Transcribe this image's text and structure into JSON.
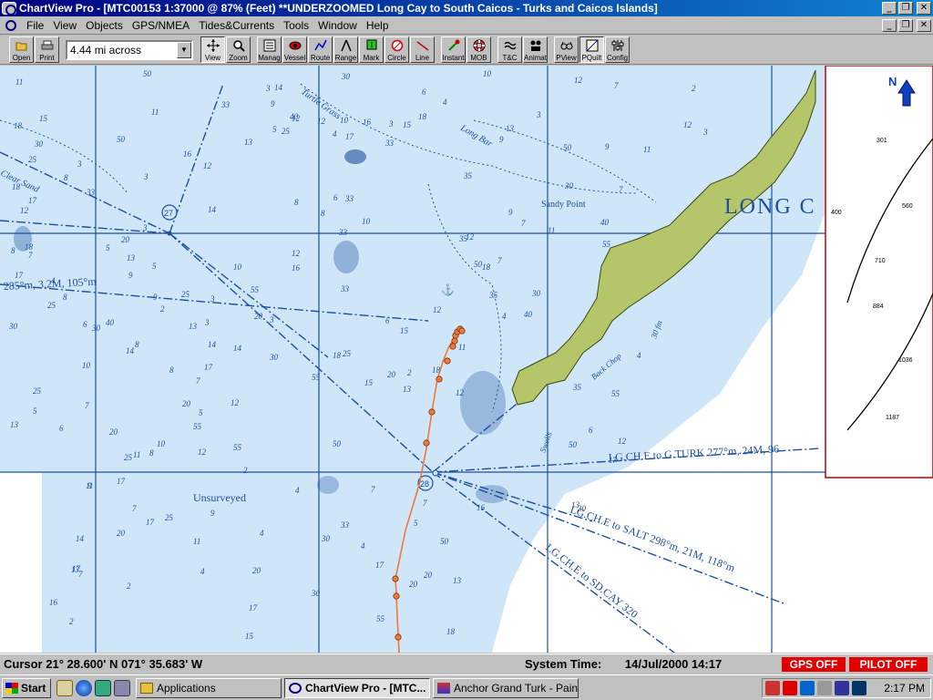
{
  "window": {
    "title": "ChartView Pro - [MTC00153 1:37000 @ 87% (Feet) **UNDERZOOMED Long Cay to South Caicos - Turks and Caicos Islands]",
    "controls": {
      "minimize": "_",
      "restore": "❐",
      "close": "✕"
    }
  },
  "menu": [
    "File",
    "View",
    "Objects",
    "GPS/NMEA",
    "Tides&Currents",
    "Tools",
    "Window",
    "Help"
  ],
  "toolbar": {
    "scale_value": "4.44 mi across",
    "buttons": [
      {
        "label": "Open",
        "icon": "open-folder-icon"
      },
      {
        "label": "Print",
        "icon": "printer-icon"
      },
      {
        "label": "View",
        "icon": "crosshair-icon"
      },
      {
        "label": "Zoom",
        "icon": "magnifier-icon"
      },
      {
        "label": "Manag",
        "icon": "manage-list-icon"
      },
      {
        "label": "Vessel",
        "icon": "vessel-eye-icon"
      },
      {
        "label": "Route",
        "icon": "route-icon"
      },
      {
        "label": "Range",
        "icon": "range-compass-icon"
      },
      {
        "label": "Mark",
        "icon": "mark-flag-icon"
      },
      {
        "label": "Circle",
        "icon": "circle-icon"
      },
      {
        "label": "Line",
        "icon": "line-icon"
      },
      {
        "label": "Instant",
        "icon": "instant-waypoint-icon"
      },
      {
        "label": "MOB",
        "icon": "lifebuoy-icon"
      },
      {
        "label": "T&C",
        "icon": "tides-currents-icon"
      },
      {
        "label": "Animat",
        "icon": "animate-icon"
      },
      {
        "label": "PView",
        "icon": "pview-glasses-icon"
      },
      {
        "label": "PQuilt",
        "icon": "pquilt-icon"
      },
      {
        "label": "Config",
        "icon": "config-sliders-icon"
      }
    ]
  },
  "chart": {
    "place_label": "LONG C",
    "labels": {
      "unsurveyed": "Unsurveyed",
      "turtle_grass": "Turtle Grass",
      "long_bar": "Long Bar",
      "sandy_point": "Sandy Point",
      "back_chop": "Back Chop",
      "swells": "Swells",
      "clear_sand": "Clear Sand",
      "bearing_285": "285°m, 3.2M, 105°m",
      "route_gturk": "LG.CH.E to G.TURK  277°m, 24M, 96",
      "route_salt": "LG.CH.E to SALT  298°m, 21M, 118°m",
      "route_sdcay": "LG.CH.E to SD.CAY  320",
      "fathom_30": "30 fm",
      "waypoint_27": "27",
      "waypoint_28": "28"
    },
    "inset": {
      "north_label": "N",
      "soundings": [
        "301",
        "400",
        "560",
        "710",
        "884",
        "1036",
        "1187"
      ]
    },
    "soundings": [
      "15",
      "14",
      "13",
      "12",
      "11",
      "10",
      "9",
      "8",
      "7",
      "6",
      "5",
      "4",
      "3",
      "2",
      "17",
      "18",
      "20",
      "25",
      "30",
      "33",
      "35",
      "50",
      "55",
      "40",
      "16"
    ],
    "colors": {
      "water": "#cfe6f9",
      "land": "#b5c56a",
      "chart_ink": "#1c4f9c",
      "track": "#f07838",
      "deep": "#ffffff"
    }
  },
  "status": {
    "cursor": "Cursor 21° 28.600' N  071° 35.683' W",
    "system_time_label": "System Time:",
    "system_time_value": "14/Jul/2000  14:17",
    "gps": "GPS OFF",
    "pilot": "PILOT OFF"
  },
  "taskbar": {
    "start": "Start",
    "tasks": [
      "Applications",
      "ChartView Pro - [MTC...",
      "Anchor Grand Turk - Paint"
    ],
    "clock": "2:17 PM"
  }
}
